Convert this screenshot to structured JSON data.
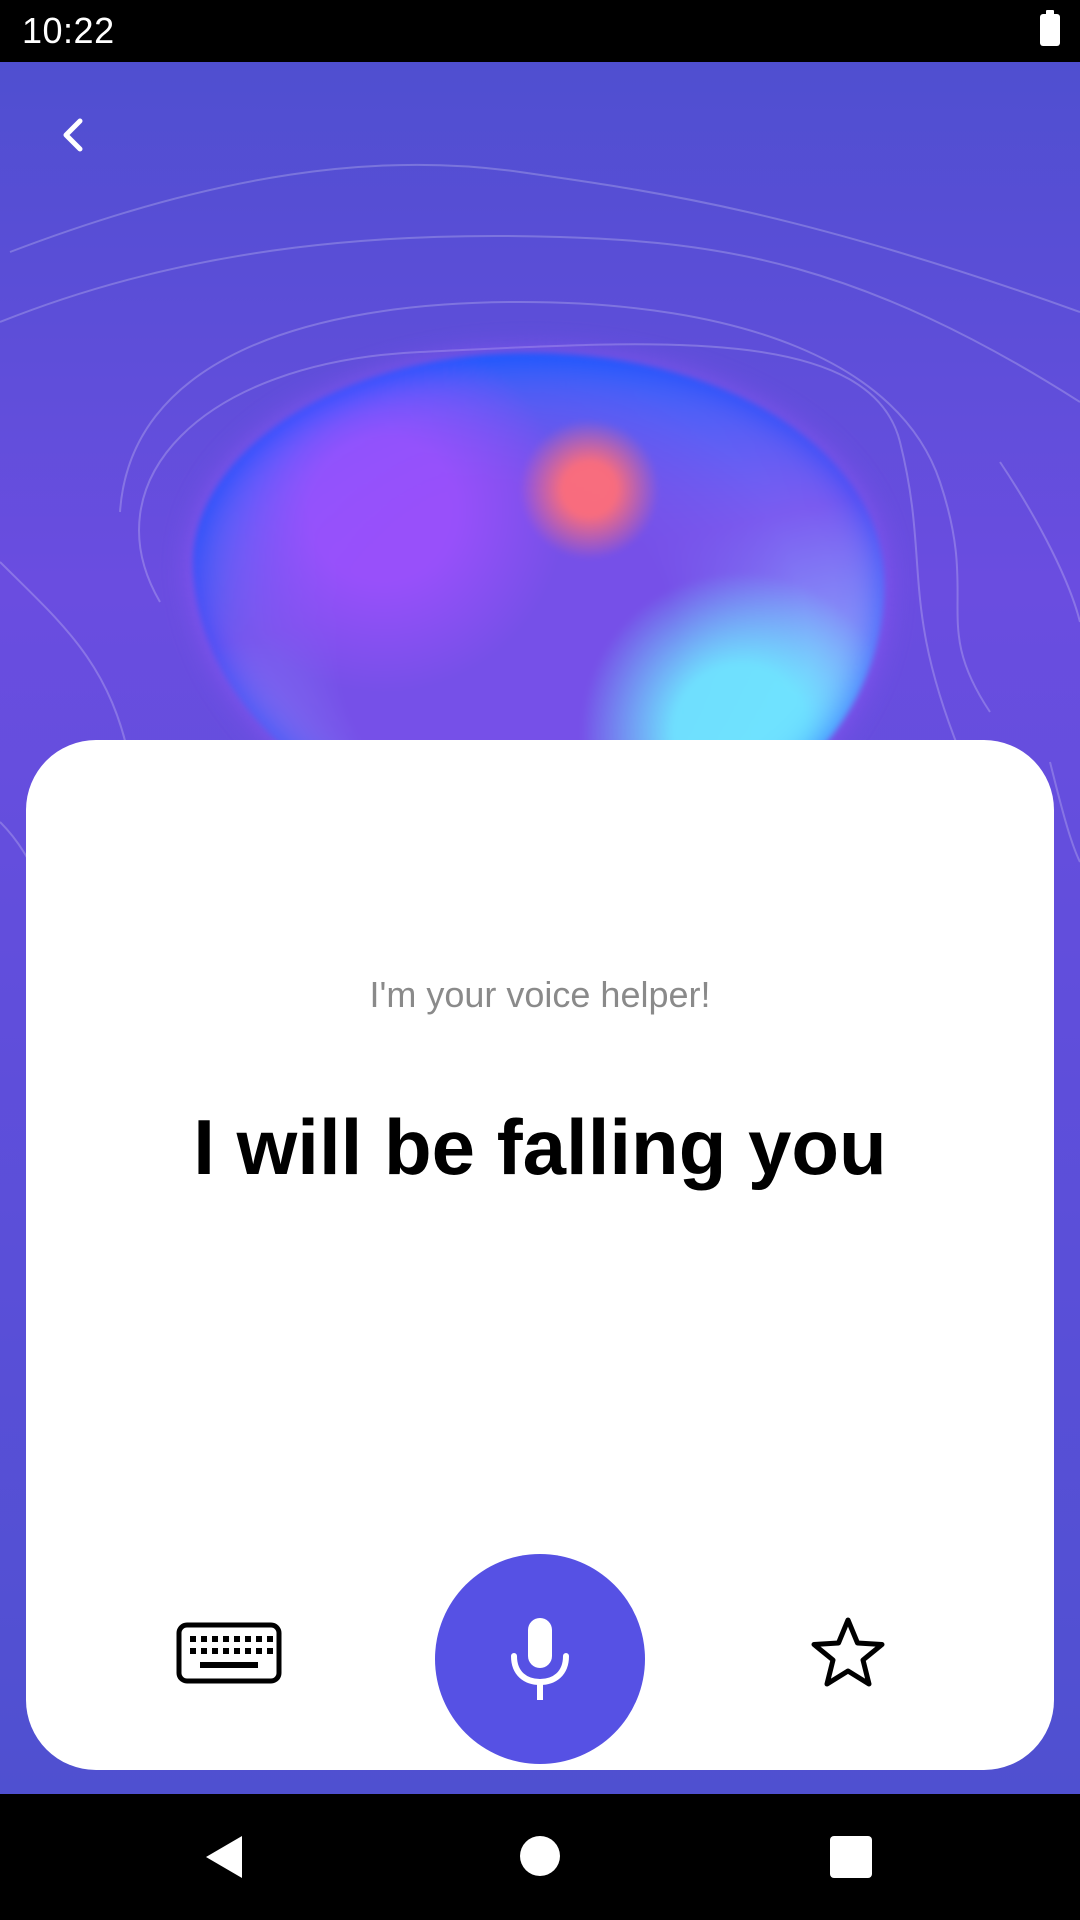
{
  "status_bar": {
    "time": "10:22"
  },
  "card": {
    "subtitle": "I'm your voice helper!",
    "title": "I will be falling you"
  },
  "icons": {
    "back": "chevron-left-icon",
    "keyboard": "keyboard-icon",
    "mic": "microphone-icon",
    "star": "star-outline-icon"
  },
  "colors": {
    "accent": "#5651e4",
    "background_top": "#4f4fd0",
    "background_mid": "#6a4de0",
    "card": "#ffffff",
    "subtitle": "#8a8a8a"
  }
}
